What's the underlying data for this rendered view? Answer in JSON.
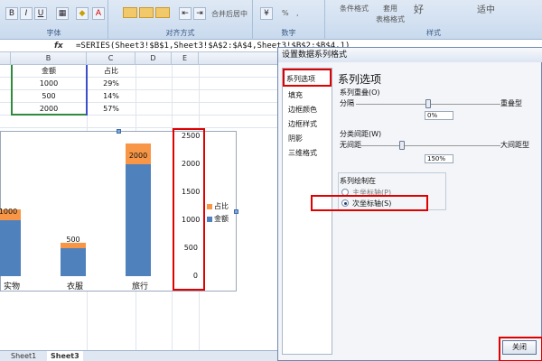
{
  "ribbon": {
    "groups": [
      "字体",
      "对齐方式",
      "数字",
      "样式"
    ],
    "merge_center": "合并后居中",
    "number_format": "%",
    "number_comma": ",",
    "cond_format": "条件格式",
    "table_format": "表格格式",
    "apply_table": "套用",
    "style_good": "好",
    "style_neutral": "适中"
  },
  "formula_bar": {
    "fx": "fx",
    "formula": "=SERIES(Sheet3!$B$1,Sheet3!$A$2:$A$4,Sheet3!$B$2:$B$4,1)"
  },
  "sheet": {
    "columns": [
      "B",
      "C",
      "D",
      "E"
    ],
    "headers": [
      "金额",
      "占比"
    ],
    "rows": [
      [
        "1000",
        "29%"
      ],
      [
        "500",
        "14%"
      ],
      [
        "2000",
        "57%"
      ]
    ],
    "tabs": [
      "Sheet1",
      "Sheet3"
    ]
  },
  "chart_data": {
    "type": "bar",
    "categories": [
      "实物",
      "衣服",
      "旅行"
    ],
    "series": [
      {
        "name": "金额",
        "values": [
          1000,
          500,
          2000
        ],
        "color": "#4f81bd"
      },
      {
        "name": "占比",
        "values": [
          0.29,
          0.14,
          0.57
        ],
        "color": "#f79646"
      }
    ],
    "data_labels": [
      "1000",
      "500",
      "2000"
    ],
    "secondary_y_ticks": [
      "2500",
      "2000",
      "1500",
      "1000",
      "500",
      "0"
    ],
    "ylim": [
      0,
      2500
    ],
    "legend": [
      "占比",
      "金额"
    ]
  },
  "dialog": {
    "title": "设置数据系列格式",
    "nav": [
      "系列选项",
      "填充",
      "边框颜色",
      "边框样式",
      "阴影",
      "三维格式"
    ],
    "section_title": "系列选项",
    "overlap": {
      "label": "系列重叠(O)",
      "left": "分隔",
      "right": "重叠型",
      "value": "0%",
      "fraction": 0.5
    },
    "gap": {
      "label": "分类间距(W)",
      "left": "无间距",
      "right": "大间距型",
      "value": "150%",
      "fraction": 0.3
    },
    "plot_on": {
      "label": "系列绘制在",
      "primary": "主坐标轴(P)",
      "secondary": "次坐标轴(S)",
      "selected": "secondary"
    },
    "close": "关闭"
  }
}
